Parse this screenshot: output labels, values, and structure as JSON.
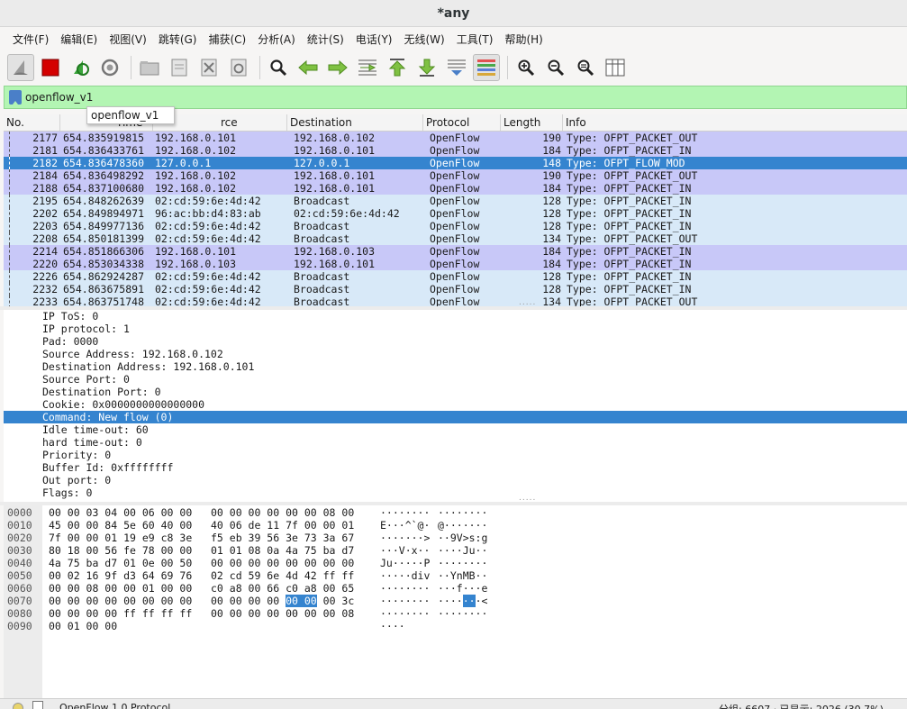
{
  "window": {
    "title": "*any"
  },
  "menu": [
    "文件(F)",
    "编辑(E)",
    "视图(V)",
    "跳转(G)",
    "捕获(C)",
    "分析(A)",
    "统计(S)",
    "电话(Y)",
    "无线(W)",
    "工具(T)",
    "帮助(H)"
  ],
  "toolbar": {
    "icons": [
      "shark-fin-icon",
      "stop-icon",
      "restart-icon",
      "gear-icon",
      "open-folder-icon",
      "save-file-icon",
      "close-file-icon",
      "reload-icon",
      "find-icon",
      "go-back-icon",
      "go-forward-icon",
      "go-to-packet-icon",
      "first-packet-icon",
      "last-packet-icon",
      "autoscroll-icon",
      "colorize-icon",
      "zoom-in-icon",
      "zoom-out-icon",
      "zoom-reset-icon",
      "resize-columns-icon"
    ]
  },
  "filter": {
    "value": "openflow_v1",
    "suggestion": "openflow_v1",
    "bg_color": "#b3f5b3"
  },
  "packet_list": {
    "headers": [
      "No.",
      "Time",
      "rce",
      "Destination",
      "Protocol",
      "Length",
      "Info"
    ],
    "rows": [
      {
        "no": "2177",
        "time": "654.835919815",
        "src": "192.168.0.101",
        "dst": "192.168.0.102",
        "proto": "OpenFlow",
        "len": "190",
        "info": "Type: OFPT_PACKET_OUT",
        "color": "#c8c8f8"
      },
      {
        "no": "2181",
        "time": "654.836433761",
        "src": "192.168.0.102",
        "dst": "192.168.0.101",
        "proto": "OpenFlow",
        "len": "184",
        "info": "Type: OFPT_PACKET_IN",
        "color": "#c8c8f8"
      },
      {
        "no": "2182",
        "time": "654.836478360",
        "src": "127.0.0.1",
        "dst": "127.0.0.1",
        "proto": "OpenFlow",
        "len": "148",
        "info": "Type: OFPT_FLOW_MOD",
        "color": "#3584cf",
        "selected": true
      },
      {
        "no": "2184",
        "time": "654.836498292",
        "src": "192.168.0.102",
        "dst": "192.168.0.101",
        "proto": "OpenFlow",
        "len": "190",
        "info": "Type: OFPT_PACKET_OUT",
        "color": "#c8c8f8"
      },
      {
        "no": "2188",
        "time": "654.837100680",
        "src": "192.168.0.102",
        "dst": "192.168.0.101",
        "proto": "OpenFlow",
        "len": "184",
        "info": "Type: OFPT_PACKET_IN",
        "color": "#c8c8f8"
      },
      {
        "no": "2195",
        "time": "654.848262639",
        "src": "02:cd:59:6e:4d:42",
        "dst": "Broadcast",
        "proto": "OpenFlow",
        "len": "128",
        "info": "Type: OFPT_PACKET_IN",
        "color": "#d8e9f8"
      },
      {
        "no": "2202",
        "time": "654.849894971",
        "src": "96:ac:bb:d4:83:ab",
        "dst": "02:cd:59:6e:4d:42",
        "proto": "OpenFlow",
        "len": "128",
        "info": "Type: OFPT_PACKET_IN",
        "color": "#d8e9f8"
      },
      {
        "no": "2203",
        "time": "654.849977136",
        "src": "02:cd:59:6e:4d:42",
        "dst": "Broadcast",
        "proto": "OpenFlow",
        "len": "128",
        "info": "Type: OFPT_PACKET_IN",
        "color": "#d8e9f8"
      },
      {
        "no": "2208",
        "time": "654.850181399",
        "src": "02:cd:59:6e:4d:42",
        "dst": "Broadcast",
        "proto": "OpenFlow",
        "len": "134",
        "info": "Type: OFPT_PACKET_OUT",
        "color": "#d8e9f8"
      },
      {
        "no": "2214",
        "time": "654.851866306",
        "src": "192.168.0.101",
        "dst": "192.168.0.103",
        "proto": "OpenFlow",
        "len": "184",
        "info": "Type: OFPT_PACKET_IN",
        "color": "#c8c8f8"
      },
      {
        "no": "2220",
        "time": "654.853034338",
        "src": "192.168.0.103",
        "dst": "192.168.0.101",
        "proto": "OpenFlow",
        "len": "184",
        "info": "Type: OFPT_PACKET_IN",
        "color": "#c8c8f8"
      },
      {
        "no": "2226",
        "time": "654.862924287",
        "src": "02:cd:59:6e:4d:42",
        "dst": "Broadcast",
        "proto": "OpenFlow",
        "len": "128",
        "info": "Type: OFPT_PACKET_IN",
        "color": "#d8e9f8"
      },
      {
        "no": "2232",
        "time": "654.863675891",
        "src": "02:cd:59:6e:4d:42",
        "dst": "Broadcast",
        "proto": "OpenFlow",
        "len": "128",
        "info": "Type: OFPT_PACKET_IN",
        "color": "#d8e9f8"
      },
      {
        "no": "2233",
        "time": "654.863751748",
        "src": "02:cd:59:6e:4d:42",
        "dst": "Broadcast",
        "proto": "OpenFlow",
        "len": "134",
        "info": "Type: OFPT_PACKET_OUT",
        "color": "#d8e9f8"
      }
    ]
  },
  "details": {
    "lines": [
      "IP ToS: 0",
      "IP protocol: 1",
      "Pad: 0000",
      "Source Address: 192.168.0.102",
      "Destination Address: 192.168.0.101",
      "Source Port: 0",
      "Destination Port: 0",
      "Cookie: 0x0000000000000000",
      "Command: New flow (0)",
      "Idle time-out: 60",
      "hard time-out: 0",
      "Priority: 0",
      "Buffer Id: 0xffffffff",
      "Out port: 0",
      "Flags: 0"
    ],
    "selected_index": 8
  },
  "bytes": {
    "rows": [
      {
        "off": "0000",
        "hex1": "00 00 03 04 00 06 00 00",
        "hex2": "00 00 00 00 00 00 08 00",
        "asc1": "········",
        "asc2": "········"
      },
      {
        "off": "0010",
        "hex1": "45 00 00 84 5e 60 40 00",
        "hex2": "40 06 de 11 7f 00 00 01",
        "asc1": "E···^`@·",
        "asc2": "@·······"
      },
      {
        "off": "0020",
        "hex1": "7f 00 00 01 19 e9 c8 3e",
        "hex2": "f5 eb 39 56 3e 73 3a 67",
        "asc1": "·······>",
        "asc2": "··9V>s:g"
      },
      {
        "off": "0030",
        "hex1": "80 18 00 56 fe 78 00 00",
        "hex2": "01 01 08 0a 4a 75 ba d7",
        "asc1": "···V·x··",
        "asc2": "····Ju··"
      },
      {
        "off": "0040",
        "hex1": "4a 75 ba d7 01 0e 00 50",
        "hex2": "00 00 00 00 00 00 00 00",
        "asc1": "Ju·····P",
        "asc2": "········"
      },
      {
        "off": "0050",
        "hex1": "00 02 16 9f d3 64 69 76",
        "hex2": "02 cd 59 6e 4d 42 ff ff",
        "asc1": "·····div",
        "asc2": "··YnMB··"
      },
      {
        "off": "0060",
        "hex1": "00 00 08 00 00 01 00 00",
        "hex2": "c0 a8 00 66 c0 a8 00 65",
        "asc1": "········",
        "asc2": "···f···e"
      },
      {
        "off": "0070",
        "hex1": "00 00 00 00 00 00 00 00",
        "hex2_pre": "00 00 00 00 ",
        "hex2_hl": "00 00",
        "hex2_post": " 00 3c",
        "asc1": "········",
        "asc2_pre": "····",
        "asc2_hl": "··",
        "asc2_post": "·<"
      },
      {
        "off": "0080",
        "hex1": "00 00 00 00 ff ff ff ff",
        "hex2": "00 00 00 00 00 00 00 08",
        "asc1": "········",
        "asc2": "········"
      },
      {
        "off": "0090",
        "hex1": "00 01 00 00",
        "hex2": "",
        "asc1": "····",
        "asc2": ""
      }
    ]
  },
  "status": {
    "left": "OpenFlow 1.0 Protocol",
    "right": "分组: 6607 · 已显示: 2026 (30.7%)"
  }
}
